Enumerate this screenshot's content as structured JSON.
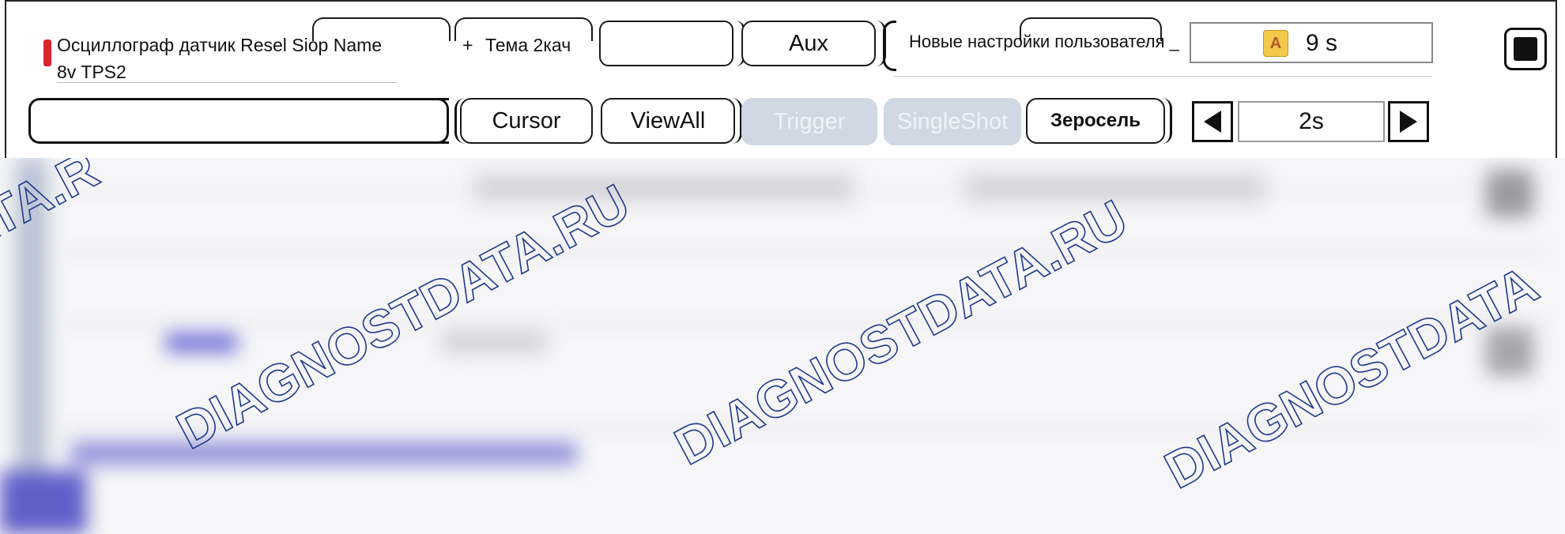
{
  "header": {
    "title_line1": "Осциллограф датчик Resel Siop Name",
    "title_line2": "8v TPS2",
    "plus": "+",
    "tab_label": "Тема 2кач",
    "aux_label": "Aux",
    "settings_label": "Новые настройки пользователя _",
    "time_value": "9 s"
  },
  "controls": {
    "cursor_label": "Cursor",
    "viewall_label": "ViewAll",
    "trigger_label": "Trigger",
    "singleshot_label": "SingleShot",
    "reset_label": "Зеросель",
    "timebase_value": "2s"
  },
  "watermark": {
    "text": "DIAGNOSTDATA.RU",
    "edge_left": "ATA.R",
    "edge_right": "DIAGNOSTDATA",
    "color": "#1e3a8a"
  },
  "colors": {
    "disabled_button": "#cfd8e3",
    "marker": "#d9252b",
    "blurred_link": "#6d6fd6"
  }
}
